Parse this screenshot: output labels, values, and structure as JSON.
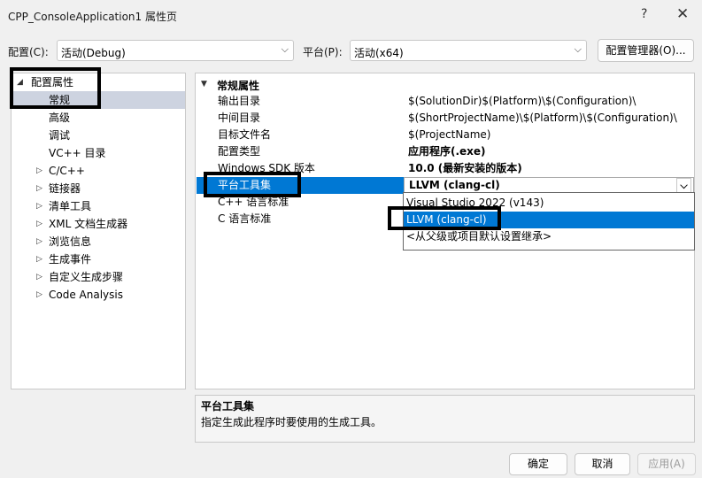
{
  "window": {
    "title": "CPP_ConsoleApplication1 属性页",
    "help_glyph": "?",
    "close_glyph": "✕"
  },
  "config_bar": {
    "config_label": "配置(C):",
    "config_value": "活动(Debug)",
    "platform_label": "平台(P):",
    "platform_value": "活动(x64)",
    "manager_button": "配置管理器(O)..."
  },
  "tree": {
    "root_label": "配置属性",
    "items": [
      {
        "label": "常规"
      },
      {
        "label": "高级"
      },
      {
        "label": "调试"
      },
      {
        "label": "VC++ 目录"
      },
      {
        "label": "C/C++"
      },
      {
        "label": "链接器"
      },
      {
        "label": "清单工具"
      },
      {
        "label": "XML 文档生成器"
      },
      {
        "label": "浏览信息"
      },
      {
        "label": "生成事件"
      },
      {
        "label": "自定义生成步骤"
      },
      {
        "label": "Code Analysis"
      }
    ]
  },
  "grid": {
    "category_label": "常规属性",
    "rows": [
      {
        "name": "输出目录",
        "value": "$(SolutionDir)$(Platform)\\$(Configuration)\\"
      },
      {
        "name": "中间目录",
        "value": "$(ShortProjectName)\\$(Platform)\\$(Configuration)\\"
      },
      {
        "name": "目标文件名",
        "value": "$(ProjectName)"
      },
      {
        "name": "配置类型",
        "value": "应用程序(.exe)"
      },
      {
        "name": "Windows SDK 版本",
        "value": "10.0 (最新安装的版本)"
      },
      {
        "name": "平台工具集",
        "value": "LLVM (clang-cl)"
      },
      {
        "name": "C++ 语言标准",
        "value": ""
      },
      {
        "name": "C 语言标准",
        "value": ""
      }
    ]
  },
  "dropdown": {
    "options": [
      {
        "label": "Visual Studio 2022 (v143)"
      },
      {
        "label": "LLVM (clang-cl)"
      },
      {
        "label": "<从父级或项目默认设置继承>"
      }
    ],
    "selected_index": 1
  },
  "description": {
    "title": "平台工具集",
    "text": "指定生成此程序时要使用的生成工具。"
  },
  "buttons": {
    "ok": "确定",
    "cancel": "取消",
    "apply": "应用(A)"
  },
  "colors": {
    "selection_blue": "#0078d4",
    "tree_selection": "#cdd3e0",
    "annotation_box": "#000000"
  }
}
